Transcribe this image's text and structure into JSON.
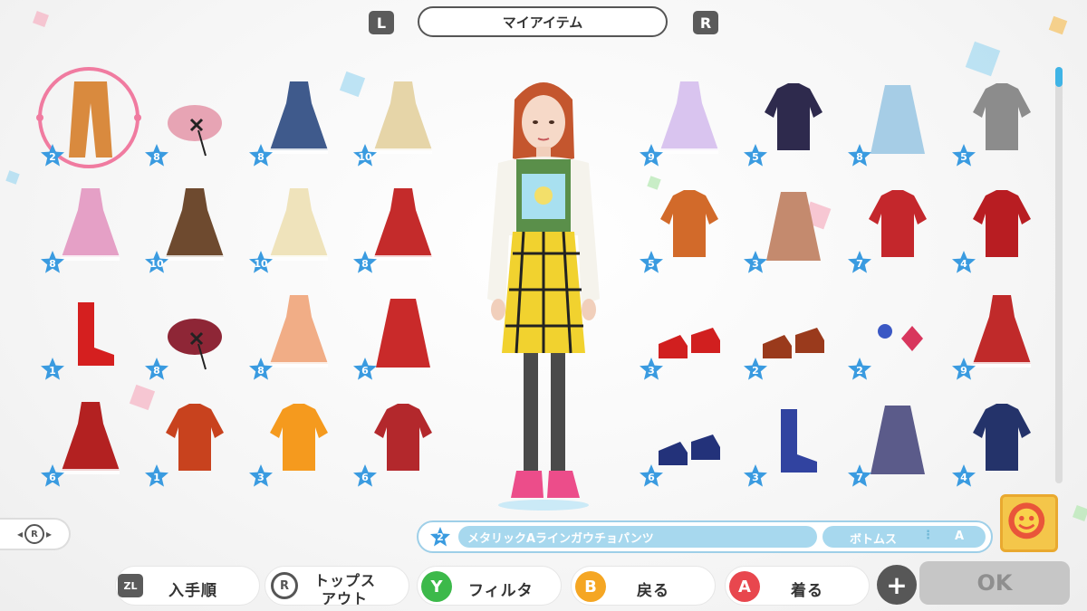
{
  "header": {
    "left_shoulder": "L",
    "right_shoulder": "R",
    "title": "マイアイテム"
  },
  "grid_left": [
    {
      "name": "orange-wide-pants",
      "count": "2",
      "selected": true
    },
    {
      "name": "pink-beret",
      "count": "8"
    },
    {
      "name": "navy-floral-dress",
      "count": "8"
    },
    {
      "name": "gold-ornate-gown",
      "count": "10"
    },
    {
      "name": "pink-pinafore-dress",
      "count": "8"
    },
    {
      "name": "brown-gothic-dress",
      "count": "10"
    },
    {
      "name": "cream-ribbon-dress",
      "count": "10"
    },
    {
      "name": "red-heart-dress",
      "count": "8"
    },
    {
      "name": "red-ankle-boots",
      "count": "1"
    },
    {
      "name": "wine-beret",
      "count": "8"
    },
    {
      "name": "peach-lolita-dress",
      "count": "8"
    },
    {
      "name": "red-polka-skirt",
      "count": "6"
    },
    {
      "name": "red-belted-dress",
      "count": "6"
    },
    {
      "name": "red-crop-top",
      "count": "1"
    },
    {
      "name": "orange-cherry-tee",
      "count": "3"
    },
    {
      "name": "red-collar-sweater",
      "count": "6"
    }
  ],
  "grid_right": [
    {
      "name": "pastel-sweet-dress",
      "count": "9"
    },
    {
      "name": "navy-pink-sweater",
      "count": "5"
    },
    {
      "name": "blue-tweed-skirt",
      "count": "8"
    },
    {
      "name": "gray-cardigan",
      "count": "5"
    },
    {
      "name": "orange-long-shirt",
      "count": "5"
    },
    {
      "name": "plaid-maxi-skirt",
      "count": "3"
    },
    {
      "name": "red-china-top",
      "count": "7"
    },
    {
      "name": "red-leather-jacket",
      "count": "4"
    },
    {
      "name": "red-heels",
      "count": "3"
    },
    {
      "name": "brown-oxfords",
      "count": "2"
    },
    {
      "name": "gem-earrings",
      "count": "2"
    },
    {
      "name": "red-frill-dress",
      "count": "9"
    },
    {
      "name": "navy-loafers",
      "count": "6"
    },
    {
      "name": "blue-knee-boots",
      "count": "3"
    },
    {
      "name": "argyle-skirt",
      "count": "7"
    },
    {
      "name": "navy-hoodie",
      "count": "4"
    }
  ],
  "info": {
    "count": "2",
    "item_name": "メタリックAラインガウチョパンツ",
    "category": "ボトムス",
    "separator": "⋮",
    "grade": "A"
  },
  "stick_left": {
    "label": "R"
  },
  "bottom": {
    "zl_label": "ZL",
    "sort_label": "入手順",
    "r_label": "R",
    "tops_out_line1": "トップス",
    "tops_out_line2": "アウト",
    "y_label": "Y",
    "filter_label": "フィルタ",
    "b_label": "B",
    "back_label": "戻る",
    "a_label": "A",
    "wear_label": "着る",
    "plus_label": "+",
    "ok_label": "OK"
  },
  "colors": {
    "star": "#3a9be0",
    "accent_pink": "#f07ba0",
    "info_blue": "#a7d8ee",
    "y_green": "#3cb94a",
    "b_orange": "#f5a623",
    "a_red": "#e8474e"
  }
}
